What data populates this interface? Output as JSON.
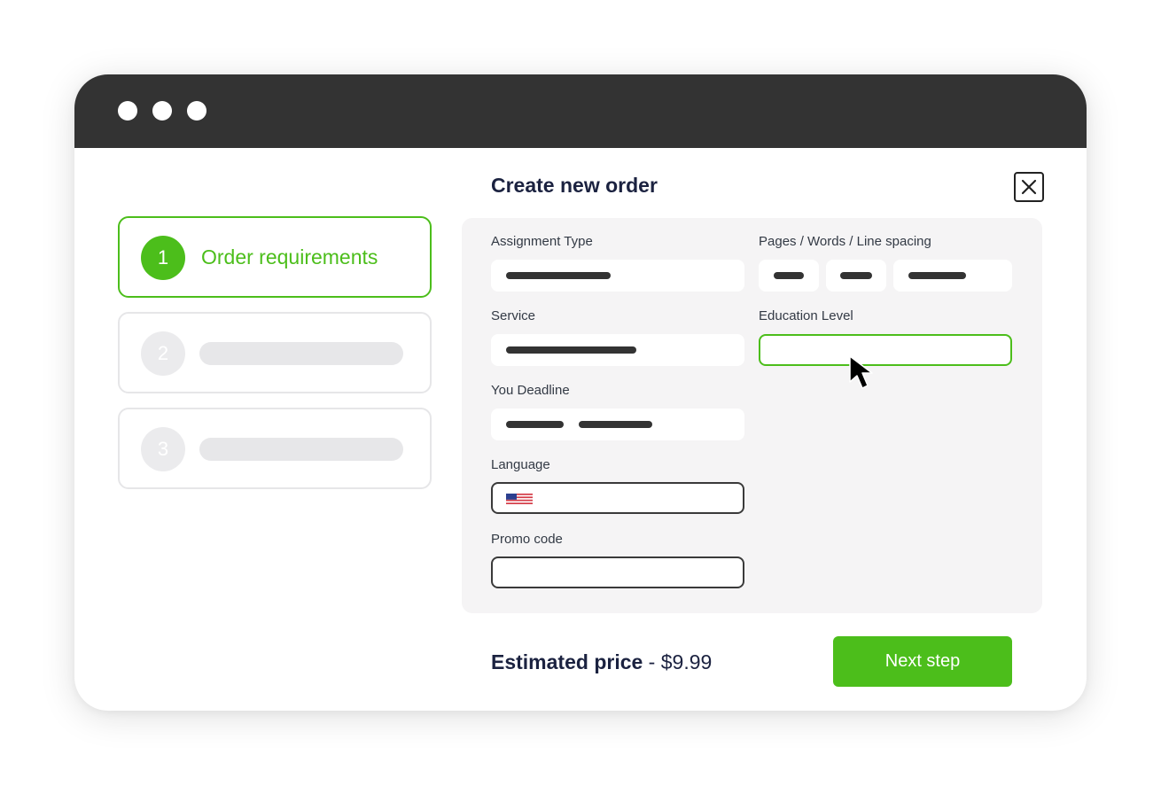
{
  "window": {
    "controls": [
      "dot-1",
      "dot-2",
      "dot-3"
    ]
  },
  "steps": [
    {
      "number": "1",
      "label": "Order requirements",
      "active": true
    },
    {
      "number": "2",
      "label": "",
      "active": false
    },
    {
      "number": "3",
      "label": "",
      "active": false
    }
  ],
  "form": {
    "title": "Create new order",
    "close_icon": "close-icon",
    "fields": {
      "assignment_type": {
        "label": "Assignment Type"
      },
      "pages_words_spacing": {
        "label": "Pages / Words / Line spacing"
      },
      "service": {
        "label": "Service"
      },
      "education_level": {
        "label": "Education Level"
      },
      "deadline": {
        "label": "You Deadline"
      },
      "language": {
        "label": "Language",
        "flag_icon": "us-flag-icon"
      },
      "promo_code": {
        "label": "Promo code"
      }
    }
  },
  "footer": {
    "price_label": "Estimated price",
    "price_separator": " - ",
    "price_value": "$9.99",
    "next_button": "Next step"
  },
  "colors": {
    "accent": "#4cbe1b",
    "title_bar": "#333333",
    "heading": "#1b2240",
    "panel": "#f5f4f5"
  }
}
